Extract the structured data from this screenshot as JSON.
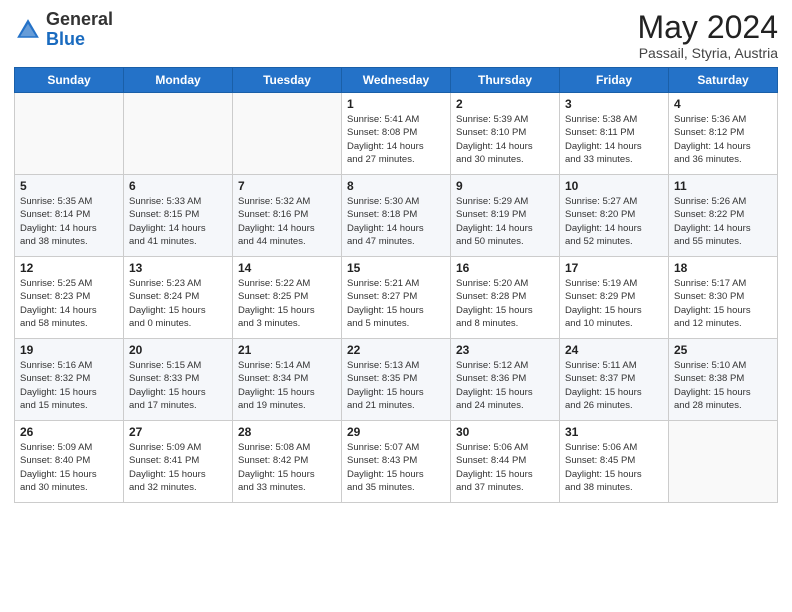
{
  "header": {
    "logo_general": "General",
    "logo_blue": "Blue",
    "month_year": "May 2024",
    "location": "Passail, Styria, Austria"
  },
  "weekdays": [
    "Sunday",
    "Monday",
    "Tuesday",
    "Wednesday",
    "Thursday",
    "Friday",
    "Saturday"
  ],
  "weeks": [
    [
      {
        "day": "",
        "info": ""
      },
      {
        "day": "",
        "info": ""
      },
      {
        "day": "",
        "info": ""
      },
      {
        "day": "1",
        "info": "Sunrise: 5:41 AM\nSunset: 8:08 PM\nDaylight: 14 hours\nand 27 minutes."
      },
      {
        "day": "2",
        "info": "Sunrise: 5:39 AM\nSunset: 8:10 PM\nDaylight: 14 hours\nand 30 minutes."
      },
      {
        "day": "3",
        "info": "Sunrise: 5:38 AM\nSunset: 8:11 PM\nDaylight: 14 hours\nand 33 minutes."
      },
      {
        "day": "4",
        "info": "Sunrise: 5:36 AM\nSunset: 8:12 PM\nDaylight: 14 hours\nand 36 minutes."
      }
    ],
    [
      {
        "day": "5",
        "info": "Sunrise: 5:35 AM\nSunset: 8:14 PM\nDaylight: 14 hours\nand 38 minutes."
      },
      {
        "day": "6",
        "info": "Sunrise: 5:33 AM\nSunset: 8:15 PM\nDaylight: 14 hours\nand 41 minutes."
      },
      {
        "day": "7",
        "info": "Sunrise: 5:32 AM\nSunset: 8:16 PM\nDaylight: 14 hours\nand 44 minutes."
      },
      {
        "day": "8",
        "info": "Sunrise: 5:30 AM\nSunset: 8:18 PM\nDaylight: 14 hours\nand 47 minutes."
      },
      {
        "day": "9",
        "info": "Sunrise: 5:29 AM\nSunset: 8:19 PM\nDaylight: 14 hours\nand 50 minutes."
      },
      {
        "day": "10",
        "info": "Sunrise: 5:27 AM\nSunset: 8:20 PM\nDaylight: 14 hours\nand 52 minutes."
      },
      {
        "day": "11",
        "info": "Sunrise: 5:26 AM\nSunset: 8:22 PM\nDaylight: 14 hours\nand 55 minutes."
      }
    ],
    [
      {
        "day": "12",
        "info": "Sunrise: 5:25 AM\nSunset: 8:23 PM\nDaylight: 14 hours\nand 58 minutes."
      },
      {
        "day": "13",
        "info": "Sunrise: 5:23 AM\nSunset: 8:24 PM\nDaylight: 15 hours\nand 0 minutes."
      },
      {
        "day": "14",
        "info": "Sunrise: 5:22 AM\nSunset: 8:25 PM\nDaylight: 15 hours\nand 3 minutes."
      },
      {
        "day": "15",
        "info": "Sunrise: 5:21 AM\nSunset: 8:27 PM\nDaylight: 15 hours\nand 5 minutes."
      },
      {
        "day": "16",
        "info": "Sunrise: 5:20 AM\nSunset: 8:28 PM\nDaylight: 15 hours\nand 8 minutes."
      },
      {
        "day": "17",
        "info": "Sunrise: 5:19 AM\nSunset: 8:29 PM\nDaylight: 15 hours\nand 10 minutes."
      },
      {
        "day": "18",
        "info": "Sunrise: 5:17 AM\nSunset: 8:30 PM\nDaylight: 15 hours\nand 12 minutes."
      }
    ],
    [
      {
        "day": "19",
        "info": "Sunrise: 5:16 AM\nSunset: 8:32 PM\nDaylight: 15 hours\nand 15 minutes."
      },
      {
        "day": "20",
        "info": "Sunrise: 5:15 AM\nSunset: 8:33 PM\nDaylight: 15 hours\nand 17 minutes."
      },
      {
        "day": "21",
        "info": "Sunrise: 5:14 AM\nSunset: 8:34 PM\nDaylight: 15 hours\nand 19 minutes."
      },
      {
        "day": "22",
        "info": "Sunrise: 5:13 AM\nSunset: 8:35 PM\nDaylight: 15 hours\nand 21 minutes."
      },
      {
        "day": "23",
        "info": "Sunrise: 5:12 AM\nSunset: 8:36 PM\nDaylight: 15 hours\nand 24 minutes."
      },
      {
        "day": "24",
        "info": "Sunrise: 5:11 AM\nSunset: 8:37 PM\nDaylight: 15 hours\nand 26 minutes."
      },
      {
        "day": "25",
        "info": "Sunrise: 5:10 AM\nSunset: 8:38 PM\nDaylight: 15 hours\nand 28 minutes."
      }
    ],
    [
      {
        "day": "26",
        "info": "Sunrise: 5:09 AM\nSunset: 8:40 PM\nDaylight: 15 hours\nand 30 minutes."
      },
      {
        "day": "27",
        "info": "Sunrise: 5:09 AM\nSunset: 8:41 PM\nDaylight: 15 hours\nand 32 minutes."
      },
      {
        "day": "28",
        "info": "Sunrise: 5:08 AM\nSunset: 8:42 PM\nDaylight: 15 hours\nand 33 minutes."
      },
      {
        "day": "29",
        "info": "Sunrise: 5:07 AM\nSunset: 8:43 PM\nDaylight: 15 hours\nand 35 minutes."
      },
      {
        "day": "30",
        "info": "Sunrise: 5:06 AM\nSunset: 8:44 PM\nDaylight: 15 hours\nand 37 minutes."
      },
      {
        "day": "31",
        "info": "Sunrise: 5:06 AM\nSunset: 8:45 PM\nDaylight: 15 hours\nand 38 minutes."
      },
      {
        "day": "",
        "info": ""
      }
    ]
  ]
}
